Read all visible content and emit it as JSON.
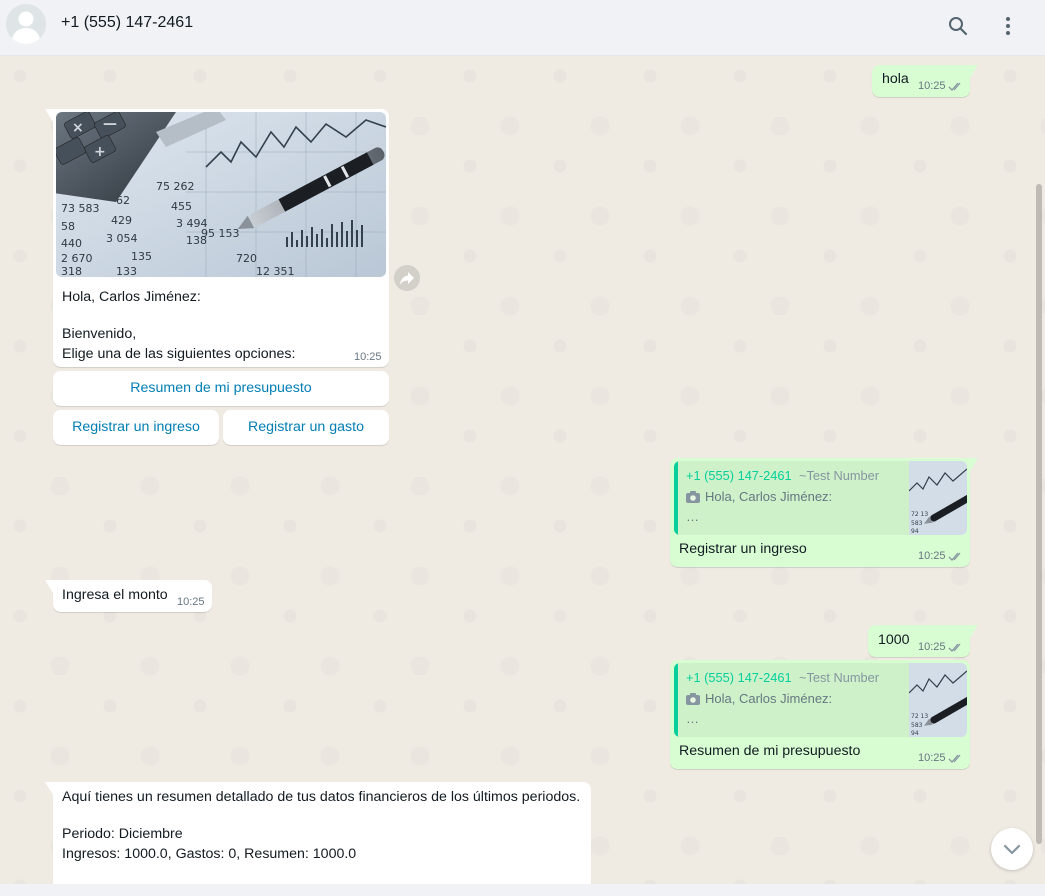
{
  "header": {
    "contact_name": "+1 (555) 147-2461"
  },
  "icons": {
    "search": "search-icon",
    "menu": "menu-icon",
    "avatar": "default-avatar-icon",
    "forward": "forward-icon",
    "scroll_down": "chevron-down-icon",
    "read_receipt": "double-check-icon",
    "camera": "camera-icon"
  },
  "colors": {
    "incoming_bubble": "#ffffff",
    "outgoing_bubble": "#d9fdd3",
    "button_text": "#027eb5",
    "quote_accent": "#06cf9c",
    "chat_background": "#efeae2",
    "header_background": "#f0f2f5"
  },
  "messages": {
    "hola": {
      "text": "hola",
      "time": "10:25"
    },
    "welcome": {
      "line1": "Hola, Carlos Jiménez:",
      "line2": "Bienvenido,",
      "line3": "Elige una de las siguientes opciones:",
      "time": "10:25",
      "image_alt": "calculator-and-pen-on-financial-charts-image"
    },
    "buttons": {
      "resumen": "Resumen de mi presupuesto",
      "ingreso": "Registrar un ingreso",
      "gasto": "Registrar un gasto"
    },
    "reply1": {
      "quote_name": "+1 (555) 147-2461",
      "quote_tag": "~Test Number",
      "quote_text": "Hola, Carlos Jiménez:",
      "quote_ellipsis": "…",
      "text": "Registrar un ingreso",
      "time": "10:25"
    },
    "ingresa": {
      "text": "Ingresa el monto",
      "time": "10:25"
    },
    "amount": {
      "text": "1000",
      "time": "10:25"
    },
    "reply2": {
      "quote_name": "+1 (555) 147-2461",
      "quote_tag": "~Test Number",
      "quote_text": "Hola, Carlos Jiménez:",
      "quote_ellipsis": "…",
      "text": "Resumen de mi presupuesto",
      "time": "10:25"
    },
    "summary": {
      "line1": "Aquí tienes un resumen detallado de tus datos financieros de los últimos periodos.",
      "line2": "Periodo: Diciembre",
      "line3": "Ingresos: 1000.0, Gastos: 0, Resumen: 1000.0"
    }
  }
}
